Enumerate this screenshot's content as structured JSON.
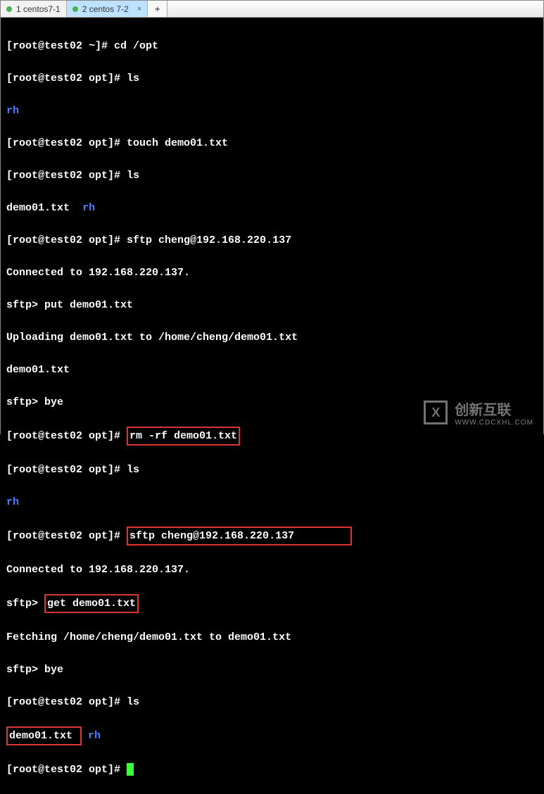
{
  "tabs": {
    "tab1": {
      "label": "1 centos7-1"
    },
    "tab2": {
      "label": "2 centos 7-2",
      "close": "×"
    },
    "add": "+"
  },
  "prompt": {
    "home": "[root@test02 ~]# ",
    "opt": "[root@test02 opt]# ",
    "sftp": "sftp> "
  },
  "cmds": {
    "cd": "cd /opt",
    "ls": "ls",
    "touch": "touch demo01.txt",
    "sftp": "sftp cheng@192.168.220.137",
    "put": "put demo01.txt",
    "bye": "bye",
    "rm": "rm -rf demo01.txt",
    "get": "get demo01.txt"
  },
  "out": {
    "rh": "rh",
    "demo_rh": "demo01.txt  ",
    "connected": "Connected to 192.168.220.137.",
    "uploading": "Uploading demo01.txt to /home/cheng/demo01.txt",
    "demo": "demo01.txt",
    "fetching": "Fetching /home/cheng/demo01.txt to demo01.txt",
    "demo_sp": "demo01.txt ",
    "sp_rh": " rh"
  },
  "watermark": {
    "logo": "X",
    "text": "创新互联",
    "sub": "WWW.CDCXHL.COM"
  }
}
